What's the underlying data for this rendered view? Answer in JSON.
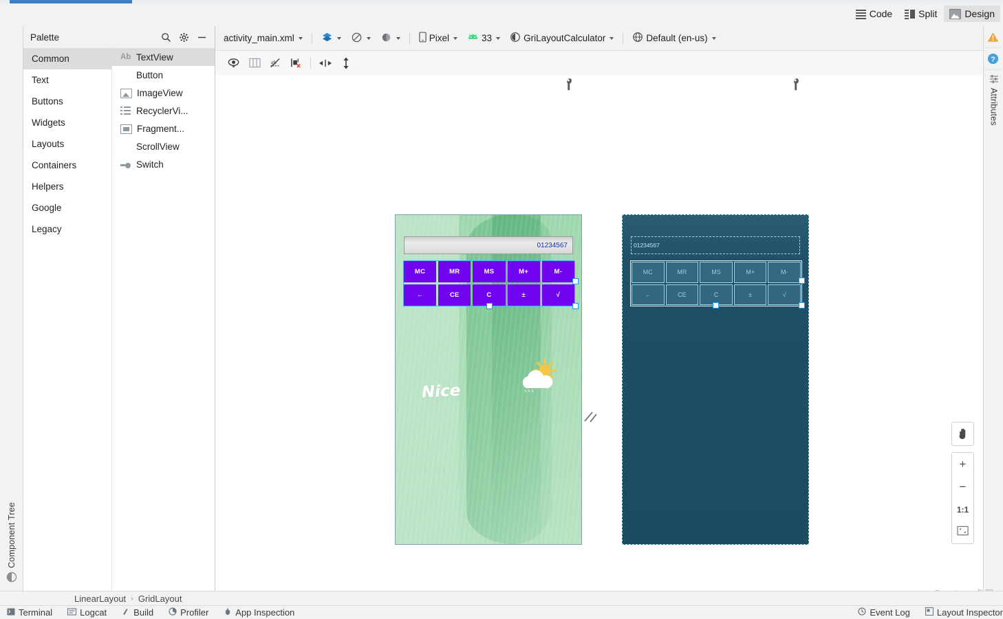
{
  "window": {
    "viewmodes": [
      {
        "id": "code",
        "label": "Code",
        "icon": "code-lines-icon",
        "active": false
      },
      {
        "id": "split",
        "label": "Split",
        "icon": "split-view-icon",
        "active": false
      },
      {
        "id": "design",
        "label": "Design",
        "icon": "design-view-icon",
        "active": true
      }
    ]
  },
  "left_rail": {
    "top_tab": {
      "label": "Palette",
      "icon": "palette-icon"
    },
    "bottom_tab": {
      "label": "Component Tree",
      "icon": "component-tree-icon"
    }
  },
  "right_rail": {
    "tab": {
      "label": "Attributes",
      "icon": "sliders-icon"
    },
    "warning_icon": "warning-triangle-icon",
    "help_icon": "help-question-icon"
  },
  "palette": {
    "title": "Palette",
    "header_buttons": [
      {
        "id": "search",
        "icon": "search-icon"
      },
      {
        "id": "settings",
        "icon": "gear-icon"
      },
      {
        "id": "minimize",
        "icon": "minimize-icon"
      }
    ],
    "categories": [
      {
        "label": "Common",
        "active": true
      },
      {
        "label": "Text",
        "active": false
      },
      {
        "label": "Buttons",
        "active": false
      },
      {
        "label": "Widgets",
        "active": false
      },
      {
        "label": "Layouts",
        "active": false
      },
      {
        "label": "Containers",
        "active": false
      },
      {
        "label": "Helpers",
        "active": false
      },
      {
        "label": "Google",
        "active": false
      },
      {
        "label": "Legacy",
        "active": false
      }
    ],
    "widgets": [
      {
        "label": "TextView",
        "icon": "textview-ab-icon",
        "active": true
      },
      {
        "label": "Button",
        "icon": "button-icon",
        "active": false
      },
      {
        "label": "ImageView",
        "icon": "imageview-icon",
        "active": false
      },
      {
        "label": "RecyclerVi...",
        "icon": "recyclerview-icon",
        "active": false
      },
      {
        "label": "Fragment...",
        "icon": "fragment-icon",
        "active": false
      },
      {
        "label": "ScrollView",
        "icon": "scrollview-icon",
        "active": false
      },
      {
        "label": "Switch",
        "icon": "switch-icon",
        "active": false
      }
    ]
  },
  "editor_toolbar": {
    "file": {
      "label": "activity_main.xml",
      "icon": "chevron-down-icon"
    },
    "design_mode_icon": "layers-icon",
    "orientation_icon": "rotate-device-icon",
    "theme_icon": "night-mode-icon",
    "device": {
      "label": "Pixel",
      "icon": "phone-icon"
    },
    "api": {
      "label": "33",
      "icon": "android-icon"
    },
    "theme": {
      "label": "GriLayoutCalculator",
      "icon": "theme-contrast-icon"
    },
    "locale": {
      "label": "Default (en-us)",
      "icon": "globe-icon"
    }
  },
  "editor_toolbar2": {
    "buttons": [
      {
        "id": "view-options",
        "icon": "eye-icon"
      },
      {
        "id": "show-margins",
        "icon": "columns-icon"
      },
      {
        "id": "no-baseline",
        "icon": "baseline-off-icon"
      },
      {
        "id": "clear-constraints",
        "icon": "clear-constraints-icon"
      },
      {
        "id": "pack-horizontal",
        "icon": "pack-horizontal-icon"
      },
      {
        "id": "expand-vertical",
        "icon": "expand-vertical-icon"
      }
    ]
  },
  "canvas": {
    "render_preview": {
      "label": "design-render-preview",
      "wrench_icon": "wrench-icon",
      "background_text": "Nice",
      "weather_icon": "sun-behind-cloud-icon",
      "display_value": "01234567",
      "buttons": [
        "MC",
        "MR",
        "MS",
        "M+",
        "M-",
        "←",
        "CE",
        "C",
        "±",
        "√"
      ],
      "button_color": "#7105f0",
      "selection_color": "#2196f3"
    },
    "blueprint_preview": {
      "label": "blueprint-preview",
      "wrench_icon": "wrench-icon",
      "display_value": "01234567",
      "buttons": [
        "MC",
        "MR",
        "MS",
        "M+",
        "M-",
        "←",
        "CE",
        "C",
        "±",
        "√"
      ],
      "background_color": "#1f5068",
      "stroke_color": "#9fd6e8"
    },
    "resize_handle_icon": "diagonal-resize-icon"
  },
  "zoom_controls": {
    "pan": {
      "icon": "pan-hand-icon"
    },
    "zoom_in": {
      "label": "+",
      "icon": "plus-icon"
    },
    "zoom_out": {
      "label": "−",
      "icon": "minus-icon"
    },
    "actual_size": {
      "label": "1:1",
      "icon": "one-to-one-icon"
    },
    "zoom_to_fit": {
      "icon": "zoom-to-fit-icon"
    }
  },
  "breadcrumb": {
    "items": [
      "LinearLayout",
      "GridLayout"
    ],
    "separator": "›"
  },
  "statusbar": {
    "items": [
      {
        "label": "Terminal",
        "icon": "terminal-icon"
      },
      {
        "label": "Logcat",
        "icon": "logcat-icon"
      },
      {
        "label": "Build",
        "icon": "build-icon"
      },
      {
        "label": "Profiler",
        "icon": "profiler-icon"
      },
      {
        "label": "App Inspection",
        "icon": "app-inspection-icon"
      }
    ],
    "right_items": [
      {
        "label": "Event Log",
        "icon": "event-log-icon"
      },
      {
        "label": "Layout Inspector",
        "icon": "layout-inspector-icon"
      }
    ]
  },
  "watermark": "CSDN @Hxiug.虚晨"
}
